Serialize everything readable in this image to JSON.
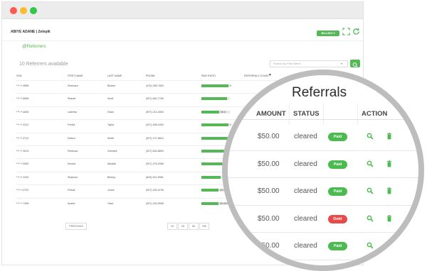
{
  "header": {
    "user_name": "ABIYE ADANE | Zelepik",
    "billing_label": "BILLING"
  },
  "page": {
    "section_title": "@Referrers",
    "count_text": "10 Referrers available",
    "search_placeholder": "Search by First Name"
  },
  "table": {
    "columns": [
      "SSN",
      "FIRST NAME",
      "LAST NAME",
      "PHONE",
      "PAID RATIO",
      "REFERRALS COUNT"
    ],
    "rows": [
      {
        "ssn": "***-**-9898",
        "first": "Shemara",
        "last": "Booker",
        "phone": "(470)-285-7820",
        "ratio": 0.95,
        "ratio_text": "9"
      },
      {
        "ssn": "***-**-8896",
        "first": "Shariel",
        "last": "Scott",
        "phone": "(907)-662-7780",
        "ratio": 0.9,
        "ratio_text": ""
      },
      {
        "ssn": "***-**-4835",
        "first": "Lateeka",
        "last": "Davis",
        "phone": "(907)-214-4063",
        "ratio": 0.62,
        "ratio_text": "55.5"
      },
      {
        "ssn": "***-**-2412",
        "first": "Fredia",
        "last": "Taylor",
        "phone": "(907)-498-4453",
        "ratio": 0.95,
        "ratio_text": "9"
      },
      {
        "ssn": "***-**-4712",
        "first": "Delora",
        "last": "Smith",
        "phone": "(907)-707-8814",
        "ratio": 0.95,
        "ratio_text": "9"
      },
      {
        "ssn": "***-**-3013",
        "first": "Rebecca",
        "last": "Gambell",
        "phone": "(907)-830-8894",
        "ratio": 0.95,
        "ratio_text": "9"
      },
      {
        "ssn": "***-**-5062",
        "first": "Keisha",
        "last": "Macklin",
        "phone": "(907)-276-2596",
        "ratio": 0.95,
        "ratio_text": "9"
      },
      {
        "ssn": "***-**-2240",
        "first": "Shannon",
        "last": "Bishop",
        "phone": "(843)-510-9961",
        "ratio": 0.68,
        "ratio_text": "58"
      },
      {
        "ssn": "***-**-0722",
        "first": "Felicia",
        "last": "Jones",
        "phone": "(907)-440-6738",
        "ratio": 0.6,
        "ratio_text": "50.00"
      },
      {
        "ssn": "***-**-7495",
        "first": "Audrie",
        "last": "Clark",
        "phone": "(907)-334-5598",
        "ratio": 0.6,
        "ratio_text": "50.00%"
      }
    ]
  },
  "pager": {
    "previous_label": "PREVIOUS",
    "sizes": [
      "10",
      "25",
      "50",
      "100"
    ]
  },
  "lens": {
    "title": "Referrals",
    "headers": {
      "amount": "AMOUNT",
      "status": "STATUS",
      "action": "ACTION"
    },
    "rows": [
      {
        "amount": "$50.00",
        "status": "cleared",
        "badge": "Paid",
        "badge_color": "#4cbb4f"
      },
      {
        "amount": "$50.00",
        "status": "cleared",
        "badge": "Paid",
        "badge_color": "#4cbb4f"
      },
      {
        "amount": "$50.00",
        "status": "cleared",
        "badge": "Paid",
        "badge_color": "#4cbb4f"
      },
      {
        "amount": "$50.00",
        "status": "cleared",
        "badge": "Debt",
        "badge_color": "#e84a47"
      },
      {
        "amount": "$50.00",
        "status": "cleared",
        "badge": "Paid",
        "badge_color": "#4cbb4f"
      }
    ],
    "icons": [
      "search-icon",
      "trash-icon"
    ]
  },
  "colors": {
    "accent": "#53b855",
    "danger": "#e84a47"
  }
}
